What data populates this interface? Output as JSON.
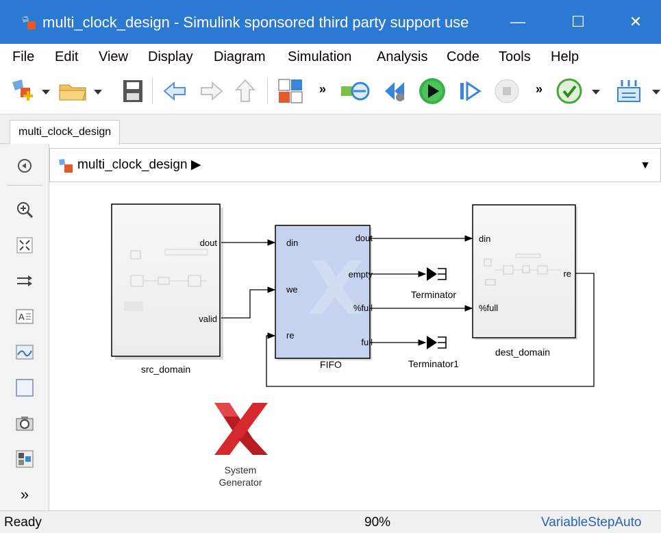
{
  "window": {
    "title": "multi_clock_design - Simulink sponsored third party support use",
    "minimize": "—",
    "maximize": "☐",
    "close": "✕"
  },
  "menu": [
    "File",
    "Edit",
    "View",
    "Display",
    "Diagram",
    "Simulation",
    "Analysis",
    "Code",
    "Tools",
    "Help"
  ],
  "toolbar": {
    "overflow_1": "»",
    "overflow_2": "»",
    "overflow_3": "»"
  },
  "model_tab": "multi_clock_design",
  "breadcrumb": {
    "model": "multi_clock_design",
    "arrow": "▶",
    "dropdown": "▼"
  },
  "blocks": {
    "src_domain": {
      "name": "src_domain",
      "ports_out": [
        "dout",
        "valid"
      ]
    },
    "fifo": {
      "name": "FIFO",
      "ports_in": [
        "din",
        "we",
        "re"
      ],
      "ports_out": [
        "dout",
        "empty",
        "%full",
        "full"
      ]
    },
    "terminator": {
      "name": "Terminator"
    },
    "terminator1": {
      "name": "Terminator1"
    },
    "dest_domain": {
      "name": "dest_domain",
      "ports_in": [
        "din",
        "%full"
      ],
      "ports_out": [
        "re"
      ]
    },
    "sysgen": {
      "line1": "System",
      "line2": "Generator"
    }
  },
  "status": {
    "state": "Ready",
    "zoom": "90%",
    "solver": "VariableStepAuto"
  },
  "colors": {
    "titlebar": "#2b79d3",
    "fifo_fill": "#c5d3ee",
    "xilinx_red": "#d42a2f"
  }
}
